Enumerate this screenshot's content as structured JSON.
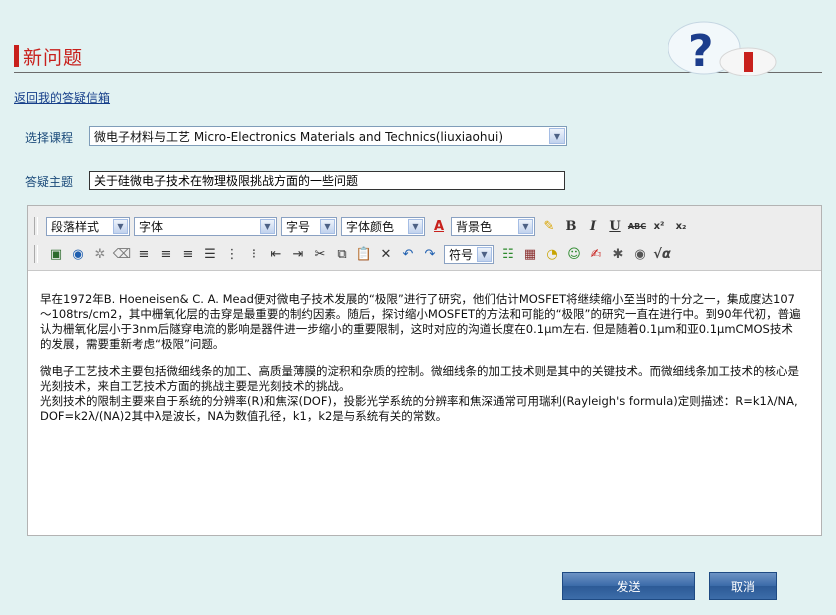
{
  "page": {
    "title": "新问题",
    "back_link": "返回我的答疑信箱"
  },
  "form": {
    "course_label": "选择课程",
    "course_value": "微电子材料与工艺 Micro-Electronics Materials and Technics(liuxiaohui)",
    "subject_label": "答疑主题",
    "subject_value": "关于硅微电子技术在物理极限挑战方面的一些问题"
  },
  "toolbar": {
    "paragraph_style": "段落样式",
    "font": "字体",
    "font_size": "字号",
    "font_color": "字体颜色",
    "background_color": "背景色",
    "symbol": "符号"
  },
  "editor": {
    "paragraphs": [
      "早在1972年B. Hoeneisen& C. A. Mead便对微电子技术发展的“极限”进行了研究，他们估计MOSFET将继续缩小至当时的十分之一，集成度达107～108trs/cm2，其中栅氧化层的击穿是最重要的制约因素。随后，探讨缩小MOSFET的方法和可能的“极限”的研究一直在进行中。到90年代初，普遍认为栅氧化层小于3nm后隧穿电流的影响是器件进一步缩小的重要限制，这时对应的沟道长度在0.1μm左右. 但是随着0.1μm和亚0.1μmCMOS技术的发展，需要重新考虑“极限”问题。",
      "微电子工艺技术主要包括微细线条的加工、高质量薄膜的淀积和杂质的控制。微细线条的加工技术则是其中的关键技术。而微细线条加工技术的核心是光刻技术，来自工艺技术方面的挑战主要是光刻技术的挑战。\n光刻技术的限制主要来自于系统的分辨率(R)和焦深(DOF)，投影光学系统的分辨率和焦深通常可用瑞利(Rayleigh's formula)定则描述：R=k1λ/NA, DOF=k2λ/(NA)2其中λ是波长，NA为数值孔径，k1，k2是与系统有关的常数。"
    ]
  },
  "buttons": {
    "send": "发送",
    "cancel": "取消"
  },
  "colors": {
    "title_red": "#c8201c",
    "page_bg": "#e2f2f2",
    "button_blue": "#3a6aa8",
    "link_blue": "#163f8a"
  }
}
